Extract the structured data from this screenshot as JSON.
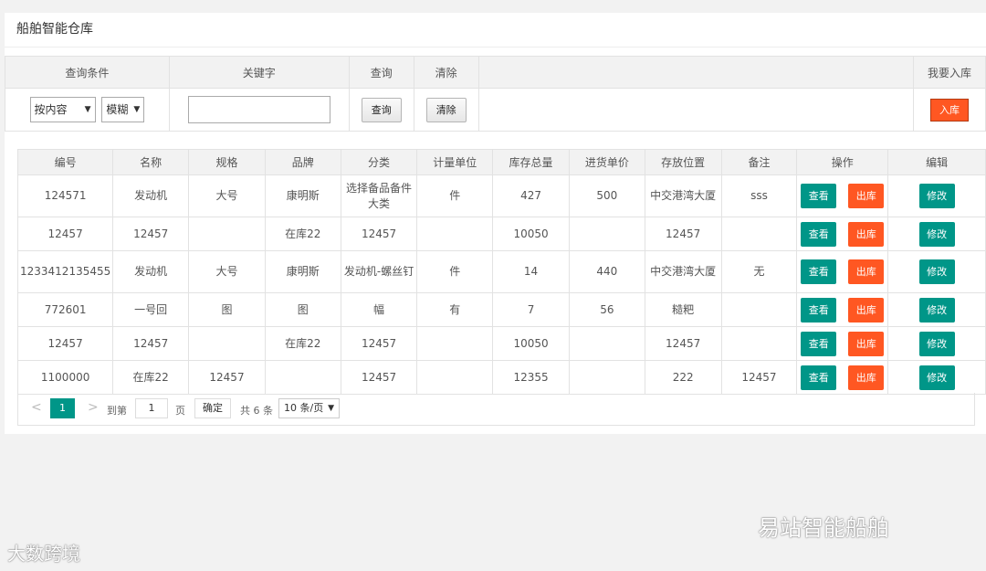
{
  "page_title": "船舶智能仓库",
  "query": {
    "headers": [
      "查询条件",
      "关键字",
      "查询",
      "清除",
      "",
      "我要入库"
    ],
    "condition_select": "按内容",
    "match_select": "模糊",
    "keyword_value": "",
    "search_label": "查询",
    "clear_label": "清除",
    "inbound_label": "入库"
  },
  "table": {
    "headers": [
      "编号",
      "名称",
      "规格",
      "品牌",
      "分类",
      "计量单位",
      "库存总量",
      "进货单价",
      "存放位置",
      "备注",
      "操作",
      "编辑"
    ],
    "view_label": "查看",
    "outbound_label": "出库",
    "edit_label": "修改",
    "rows": [
      [
        "124571",
        "发动机",
        "大号",
        "康明斯",
        "选择备品备件大类",
        "件",
        "427",
        "500",
        "中交港湾大厦",
        "sss"
      ],
      [
        "12457",
        "12457",
        "",
        "在库22",
        "12457",
        "",
        "10050",
        "",
        "12457",
        ""
      ],
      [
        "1233412135455",
        "发动机",
        "大号",
        "康明斯",
        "发动机-螺丝钉",
        "件",
        "14",
        "440",
        "中交港湾大厦",
        "无"
      ],
      [
        "772601",
        "一号回",
        "图",
        "图",
        "幅",
        "有",
        "7",
        "56",
        "糙粑",
        ""
      ],
      [
        "12457",
        "12457",
        "",
        "在库22",
        "12457",
        "",
        "10050",
        "",
        "12457",
        ""
      ],
      [
        "1100000",
        "在库22",
        "12457",
        "",
        "12457",
        "",
        "12355",
        "",
        "222",
        "12457"
      ]
    ]
  },
  "pager": {
    "prev": "<",
    "current": "1",
    "next": ">",
    "goto_label": "到第",
    "goto_value": "1",
    "page_unit": "页",
    "confirm": "确定",
    "total": "共 6 条",
    "page_size": "10 条/页"
  },
  "watermark_right": "易站智能船舶",
  "watermark_left": "大数跨境"
}
